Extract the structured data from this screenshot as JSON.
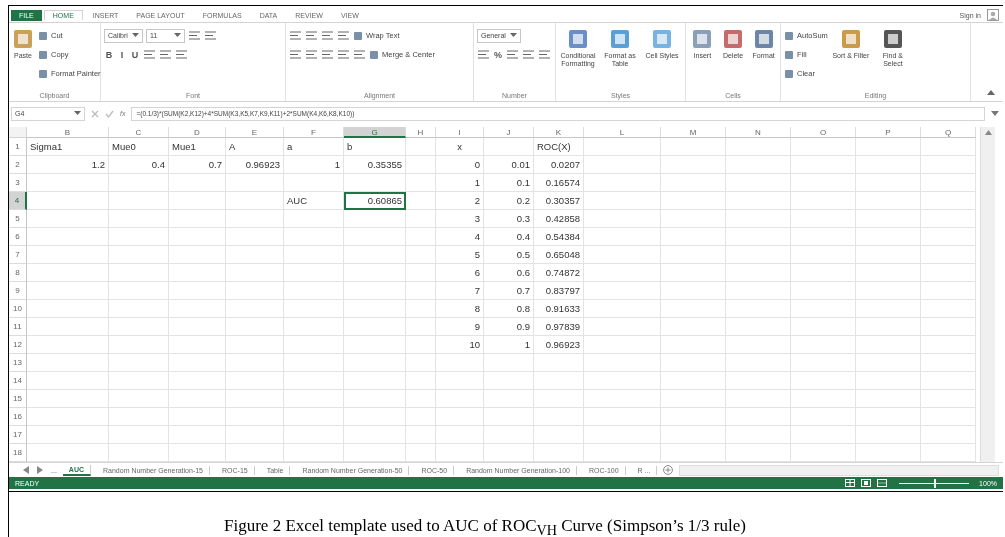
{
  "title_bar": {
    "sign_in": "Sign in"
  },
  "menu_tabs": [
    {
      "label": "FILE",
      "kind": "file",
      "selected": false
    },
    {
      "label": "HOME",
      "kind": "tab",
      "selected": true
    },
    {
      "label": "INSERT",
      "kind": "tab",
      "selected": false
    },
    {
      "label": "PAGE LAYOUT",
      "kind": "tab",
      "selected": false
    },
    {
      "label": "FORMULAS",
      "kind": "tab",
      "selected": false
    },
    {
      "label": "DATA",
      "kind": "tab",
      "selected": false
    },
    {
      "label": "REVIEW",
      "kind": "tab",
      "selected": false
    },
    {
      "label": "VIEW",
      "kind": "tab",
      "selected": false
    }
  ],
  "ribbon": {
    "groups": [
      {
        "label": "Clipboard",
        "parts": [
          {
            "kind": "big",
            "label": "Paste"
          },
          {
            "kind": "lines",
            "lines": [
              {
                "items": [
                  {
                    "kind": "small",
                    "label": "Cut"
                  }
                ]
              },
              {
                "items": [
                  {
                    "kind": "small",
                    "label": "Copy"
                  }
                ]
              },
              {
                "items": [
                  {
                    "kind": "small",
                    "label": "Format Painter"
                  }
                ]
              }
            ]
          }
        ]
      },
      {
        "label": "Font",
        "parts": [
          {
            "kind": "lines",
            "lines": [
              {
                "items": [
                  {
                    "kind": "field",
                    "value": "Calibri"
                  },
                  {
                    "kind": "field",
                    "value": "11"
                  },
                  {
                    "kind": "icon"
                  },
                  {
                    "kind": "icon"
                  }
                ]
              },
              {
                "items": [
                  {
                    "kind": "glyph",
                    "label": "B"
                  },
                  {
                    "kind": "glyph",
                    "label": "I"
                  },
                  {
                    "kind": "glyph",
                    "label": "U"
                  },
                  {
                    "kind": "icon"
                  },
                  {
                    "kind": "icon"
                  },
                  {
                    "kind": "icon"
                  }
                ]
              }
            ]
          }
        ]
      },
      {
        "label": "Alignment",
        "parts": [
          {
            "kind": "lines",
            "lines": [
              {
                "items": [
                  {
                    "kind": "icon"
                  },
                  {
                    "kind": "icon"
                  },
                  {
                    "kind": "icon"
                  },
                  {
                    "kind": "icon"
                  },
                  {
                    "kind": "small",
                    "label": "Wrap Text"
                  }
                ]
              },
              {
                "items": [
                  {
                    "kind": "icon"
                  },
                  {
                    "kind": "icon"
                  },
                  {
                    "kind": "icon"
                  },
                  {
                    "kind": "icon"
                  },
                  {
                    "kind": "icon"
                  },
                  {
                    "kind": "small",
                    "label": "Merge & Center"
                  }
                ]
              }
            ]
          }
        ]
      },
      {
        "label": "Number",
        "parts": [
          {
            "kind": "lines",
            "lines": [
              {
                "items": [
                  {
                    "kind": "field",
                    "value": "General"
                  }
                ]
              },
              {
                "items": [
                  {
                    "kind": "icon"
                  },
                  {
                    "kind": "glyph",
                    "label": "%"
                  },
                  {
                    "kind": "icon"
                  },
                  {
                    "kind": "icon"
                  },
                  {
                    "kind": "icon"
                  }
                ]
              }
            ]
          }
        ]
      },
      {
        "label": "Styles",
        "parts": [
          {
            "kind": "big",
            "label": "Conditional Formatting"
          },
          {
            "kind": "big",
            "label": "Format as Table"
          },
          {
            "kind": "big",
            "label": "Cell Styles"
          }
        ]
      },
      {
        "label": "Cells",
        "parts": [
          {
            "kind": "big",
            "label": "Insert"
          },
          {
            "kind": "big",
            "label": "Delete"
          },
          {
            "kind": "big",
            "label": "Format"
          }
        ]
      },
      {
        "label": "Editing",
        "parts": [
          {
            "kind": "lines",
            "lines": [
              {
                "items": [
                  {
                    "kind": "small",
                    "label": "AutoSum"
                  }
                ]
              },
              {
                "items": [
                  {
                    "kind": "small",
                    "label": "Fill"
                  }
                ]
              },
              {
                "items": [
                  {
                    "kind": "small",
                    "label": "Clear"
                  }
                ]
              }
            ]
          },
          {
            "kind": "big",
            "label": "Sort & Filter"
          },
          {
            "kind": "big",
            "label": "Find & Select"
          }
        ]
      }
    ]
  },
  "formula_bar": {
    "name_box": "G4",
    "function_label": "fx",
    "formula": "=(0.1/3)*(SUM(K2,K12)+4*SUM(K3,K5,K7,K9,K11)+2*SUM(K4,K6,K8,K10))"
  },
  "sheet": {
    "columns": [
      {
        "label": "B",
        "selected": false
      },
      {
        "label": "C",
        "selected": false
      },
      {
        "label": "D",
        "selected": false
      },
      {
        "label": "E",
        "selected": false
      },
      {
        "label": "F",
        "selected": false
      },
      {
        "label": "G",
        "selected": true
      },
      {
        "label": "H",
        "selected": false
      },
      {
        "label": "I",
        "selected": false
      },
      {
        "label": "J",
        "selected": false
      },
      {
        "label": "K",
        "selected": false
      },
      {
        "label": "L",
        "selected": false
      },
      {
        "label": "M",
        "selected": false
      },
      {
        "label": "N",
        "selected": false
      },
      {
        "label": "O",
        "selected": false
      },
      {
        "label": "P",
        "selected": false
      },
      {
        "label": "Q",
        "selected": false
      }
    ],
    "rows": [
      {
        "number": "1",
        "selected": false,
        "cells": [
          {
            "value": "Sigma1",
            "kind": "text",
            "selected": false
          },
          {
            "value": "Mue0",
            "kind": "text",
            "selected": false
          },
          {
            "value": "Mue1",
            "kind": "text",
            "selected": false
          },
          {
            "value": "A",
            "kind": "text",
            "selected": false
          },
          {
            "value": "a",
            "kind": "text",
            "selected": false
          },
          {
            "value": "b",
            "kind": "text",
            "selected": false
          },
          {
            "selected": false
          },
          {
            "value": "x",
            "kind": "center",
            "selected": false
          },
          {
            "selected": false
          },
          {
            "value": "ROC(X)",
            "kind": "text",
            "selected": false
          }
        ]
      },
      {
        "number": "2",
        "selected": false,
        "cells": [
          {
            "value": "1.2",
            "kind": "number",
            "selected": false
          },
          {
            "value": "0.4",
            "kind": "number",
            "selected": false
          },
          {
            "value": "0.7",
            "kind": "number",
            "selected": false
          },
          {
            "value": "0.96923",
            "kind": "number",
            "selected": false
          },
          {
            "value": "1",
            "kind": "number",
            "selected": false
          },
          {
            "value": "0.35355",
            "kind": "number",
            "selected": false
          },
          {
            "selected": false
          },
          {
            "value": "0",
            "kind": "number",
            "selected": false
          },
          {
            "value": "0.01",
            "kind": "number",
            "selected": false
          },
          {
            "value": "0.0207",
            "kind": "number",
            "selected": false
          }
        ]
      },
      {
        "number": "3",
        "selected": false,
        "cells": [
          {
            "selected": false
          },
          {
            "selected": false
          },
          {
            "selected": false
          },
          {
            "selected": false
          },
          {
            "selected": false
          },
          {
            "selected": false
          },
          {
            "selected": false
          },
          {
            "value": "1",
            "kind": "number",
            "selected": false
          },
          {
            "value": "0.1",
            "kind": "number",
            "selected": false
          },
          {
            "value": "0.16574",
            "kind": "number",
            "selected": false
          }
        ]
      },
      {
        "number": "4",
        "selected": true,
        "cells": [
          {
            "selected": false
          },
          {
            "selected": false
          },
          {
            "selected": false
          },
          {
            "selected": false
          },
          {
            "value": "AUC",
            "kind": "text",
            "selected": false
          },
          {
            "value": "0.60865",
            "kind": "number",
            "selected": true
          },
          {
            "selected": false
          },
          {
            "value": "2",
            "kind": "number",
            "selected": false
          },
          {
            "value": "0.2",
            "kind": "number",
            "selected": false
          },
          {
            "value": "0.30357",
            "kind": "number",
            "selected": false
          }
        ]
      },
      {
        "number": "5",
        "selected": false,
        "cells": [
          {
            "selected": false
          },
          {
            "selected": false
          },
          {
            "selected": false
          },
          {
            "selected": false
          },
          {
            "selected": false
          },
          {
            "selected": false
          },
          {
            "selected": false
          },
          {
            "value": "3",
            "kind": "number",
            "selected": false
          },
          {
            "value": "0.3",
            "kind": "number",
            "selected": false
          },
          {
            "value": "0.42858",
            "kind": "number",
            "selected": false
          }
        ]
      },
      {
        "number": "6",
        "selected": false,
        "cells": [
          {
            "selected": false
          },
          {
            "selected": false
          },
          {
            "selected": false
          },
          {
            "selected": false
          },
          {
            "selected": false
          },
          {
            "selected": false
          },
          {
            "selected": false
          },
          {
            "value": "4",
            "kind": "number",
            "selected": false
          },
          {
            "value": "0.4",
            "kind": "number",
            "selected": false
          },
          {
            "value": "0.54384",
            "kind": "number",
            "selected": false
          }
        ]
      },
      {
        "number": "7",
        "selected": false,
        "cells": [
          {
            "selected": false
          },
          {
            "selected": false
          },
          {
            "selected": false
          },
          {
            "selected": false
          },
          {
            "selected": false
          },
          {
            "selected": false
          },
          {
            "selected": false
          },
          {
            "value": "5",
            "kind": "number",
            "selected": false
          },
          {
            "value": "0.5",
            "kind": "number",
            "selected": false
          },
          {
            "value": "0.65048",
            "kind": "number",
            "selected": false
          }
        ]
      },
      {
        "number": "8",
        "selected": false,
        "cells": [
          {
            "selected": false
          },
          {
            "selected": false
          },
          {
            "selected": false
          },
          {
            "selected": false
          },
          {
            "selected": false
          },
          {
            "selected": false
          },
          {
            "selected": false
          },
          {
            "value": "6",
            "kind": "number",
            "selected": false
          },
          {
            "value": "0.6",
            "kind": "number",
            "selected": false
          },
          {
            "value": "0.74872",
            "kind": "number",
            "selected": false
          }
        ]
      },
      {
        "number": "9",
        "selected": false,
        "cells": [
          {
            "selected": false
          },
          {
            "selected": false
          },
          {
            "selected": false
          },
          {
            "selected": false
          },
          {
            "selected": false
          },
          {
            "selected": false
          },
          {
            "selected": false
          },
          {
            "value": "7",
            "kind": "number",
            "selected": false
          },
          {
            "value": "0.7",
            "kind": "number",
            "selected": false
          },
          {
            "value": "0.83797",
            "kind": "number",
            "selected": false
          }
        ]
      },
      {
        "number": "10",
        "selected": false,
        "cells": [
          {
            "selected": false
          },
          {
            "selected": false
          },
          {
            "selected": false
          },
          {
            "selected": false
          },
          {
            "selected": false
          },
          {
            "selected": false
          },
          {
            "selected": false
          },
          {
            "value": "8",
            "kind": "number",
            "selected": false
          },
          {
            "value": "0.8",
            "kind": "number",
            "selected": false
          },
          {
            "value": "0.91633",
            "kind": "number",
            "selected": false
          }
        ]
      },
      {
        "number": "11",
        "selected": false,
        "cells": [
          {
            "selected": false
          },
          {
            "selected": false
          },
          {
            "selected": false
          },
          {
            "selected": false
          },
          {
            "selected": false
          },
          {
            "selected": false
          },
          {
            "selected": false
          },
          {
            "value": "9",
            "kind": "number",
            "selected": false
          },
          {
            "value": "0.9",
            "kind": "number",
            "selected": false
          },
          {
            "value": "0.97839",
            "kind": "number",
            "selected": false
          }
        ]
      },
      {
        "number": "12",
        "selected": false,
        "cells": [
          {
            "selected": false
          },
          {
            "selected": false
          },
          {
            "selected": false
          },
          {
            "selected": false
          },
          {
            "selected": false
          },
          {
            "selected": false
          },
          {
            "selected": false
          },
          {
            "value": "10",
            "kind": "number",
            "selected": false
          },
          {
            "value": "1",
            "kind": "number",
            "selected": false
          },
          {
            "value": "0.96923",
            "kind": "number",
            "selected": false
          }
        ]
      },
      {
        "number": "13",
        "selected": false,
        "cells": []
      },
      {
        "number": "14",
        "selected": false,
        "cells": []
      },
      {
        "number": "15",
        "selected": false,
        "cells": []
      },
      {
        "number": "16",
        "selected": false,
        "cells": []
      },
      {
        "number": "17",
        "selected": false,
        "cells": []
      },
      {
        "number": "18",
        "selected": false,
        "cells": []
      }
    ]
  },
  "sheet_tabs": {
    "overflow": "...",
    "tabs": [
      {
        "label": "AUC",
        "selected": true
      },
      {
        "label": "Random Number Generation-15",
        "selected": false
      },
      {
        "label": "ROC-15",
        "selected": false
      },
      {
        "label": "Table",
        "selected": false
      },
      {
        "label": "Random Number Generation-50",
        "selected": false
      },
      {
        "label": "ROC-50",
        "selected": false
      },
      {
        "label": "Random Number Generation-100",
        "selected": false
      },
      {
        "label": "ROC-100",
        "selected": false
      },
      {
        "label": "R ...",
        "selected": false
      }
    ]
  },
  "status_bar": {
    "status": "READY",
    "zoom": {
      "level": 0.5,
      "reading": "100%"
    }
  },
  "caption": "Figure 2 Excel template used to AUC of ROC$_{VH}$ Curve (Simpson’s 1/3 rule)"
}
